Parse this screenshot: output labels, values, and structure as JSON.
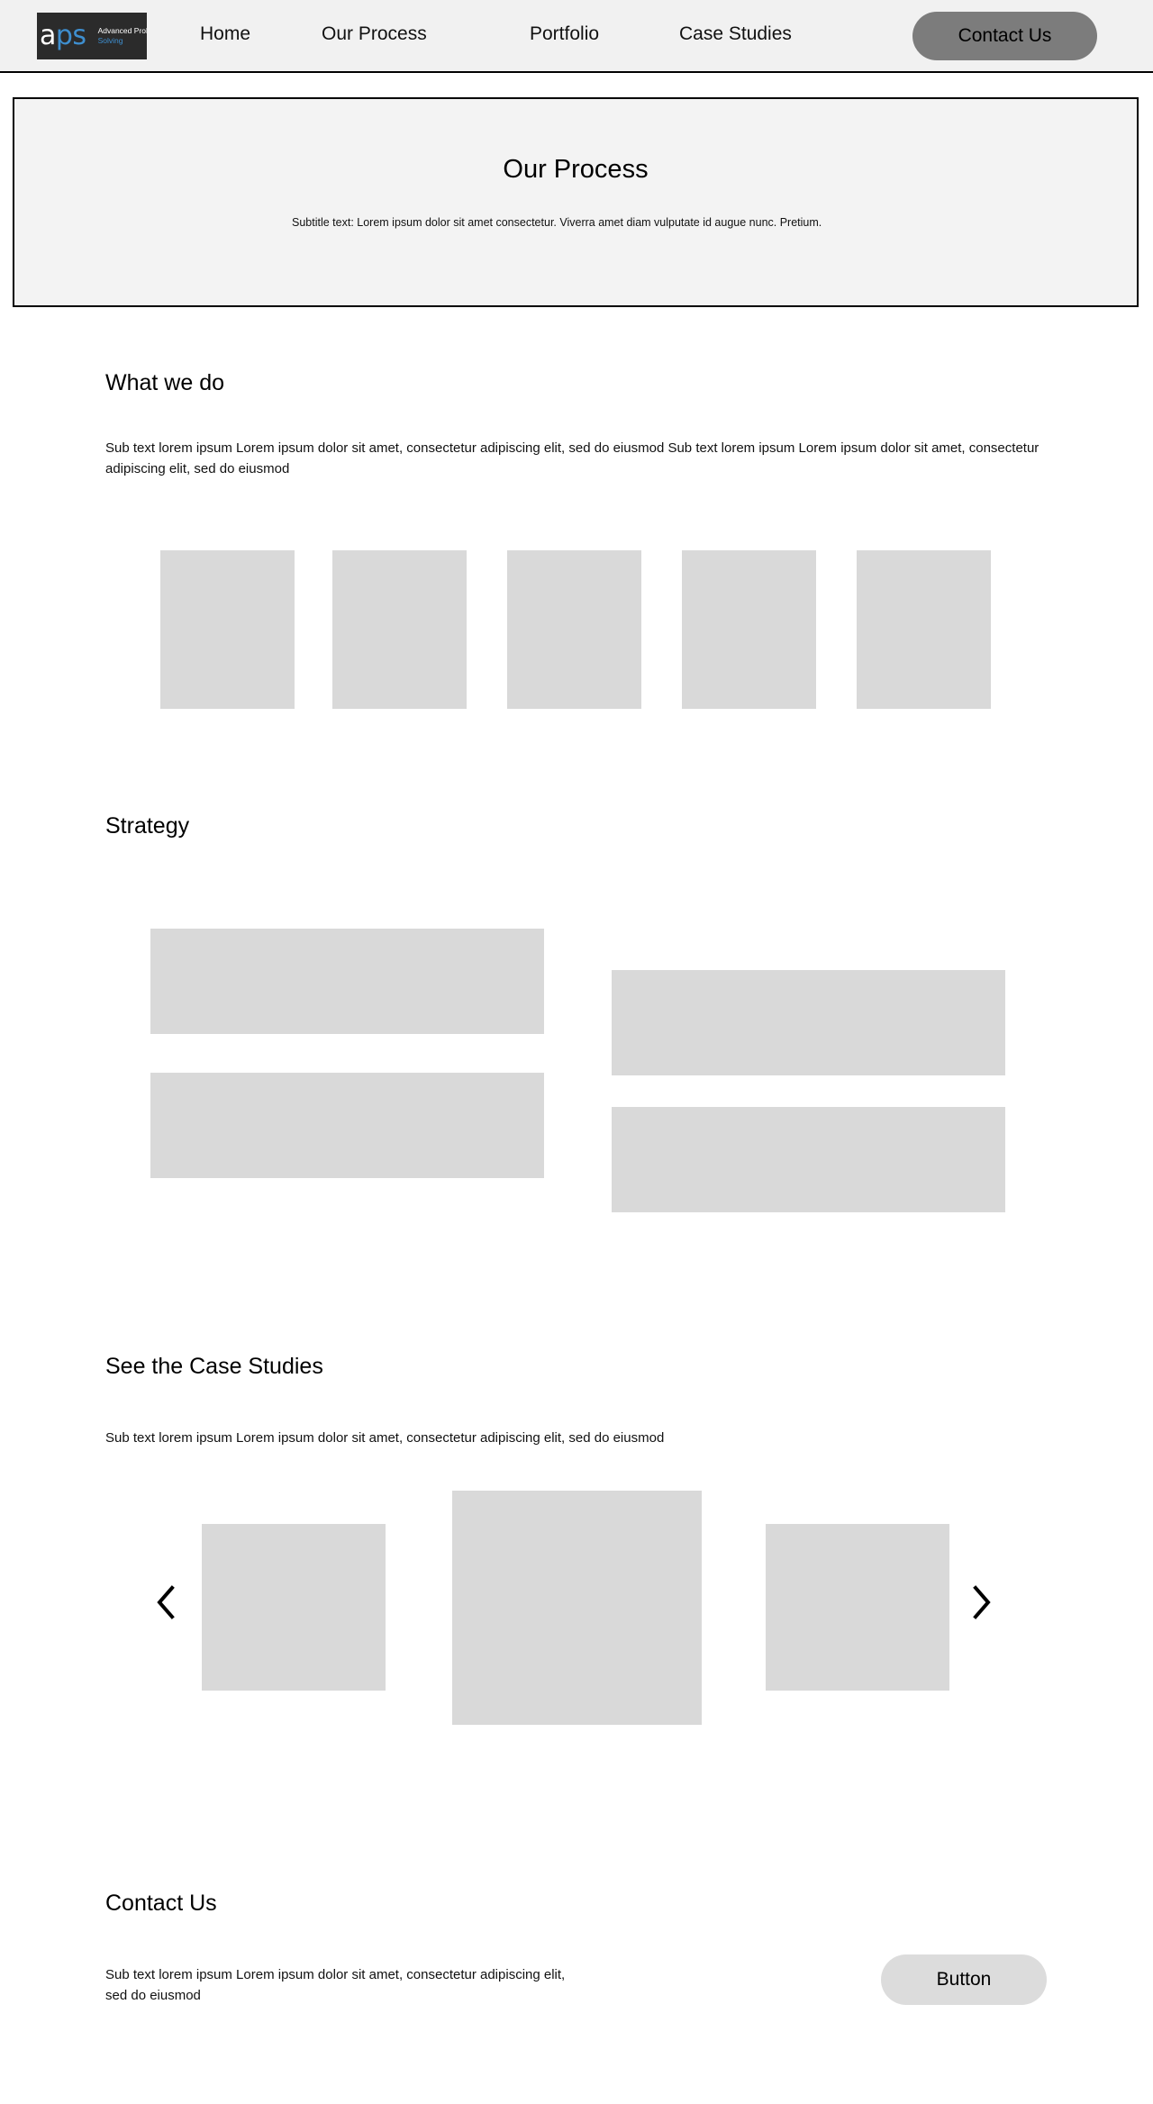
{
  "header": {
    "logo": {
      "mark_a": "a",
      "mark_ps": "ps",
      "tagline_line1": "Advanced Problem",
      "tagline_line2": "Solving"
    },
    "nav_items": [
      {
        "label": "Home"
      },
      {
        "label": "Our Process"
      },
      {
        "label": "Portfolio"
      },
      {
        "label": "Case Studies"
      }
    ],
    "contact_button_label": "Contact Us"
  },
  "hero": {
    "title": "Our Process",
    "subtitle": "Subtitle text: Lorem ipsum dolor sit amet consectetur. Viverra amet diam vulputate id augue nunc. Pretium."
  },
  "what_we_do": {
    "title": "What we do",
    "subtitle": "Sub text lorem ipsum Lorem ipsum dolor sit amet, consectetur adipiscing elit, sed do eiusmod Sub text lorem ipsum Lorem ipsum dolor sit amet, consectetur adipiscing elit, sed do eiusmod",
    "cards": [
      {
        "label": ""
      },
      {
        "label": ""
      },
      {
        "label": ""
      },
      {
        "label": ""
      },
      {
        "label": ""
      }
    ]
  },
  "strategy": {
    "title": "Strategy",
    "cards": [
      {
        "label": ""
      },
      {
        "label": ""
      },
      {
        "label": ""
      },
      {
        "label": ""
      }
    ]
  },
  "case_studies": {
    "title": "See the Case Studies",
    "subtitle": "Sub text lorem ipsum Lorem ipsum dolor sit amet, consectetur adipiscing elit, sed do eiusmod",
    "prev_icon": "chevron-left-icon",
    "next_icon": "chevron-right-icon",
    "slides": [
      {
        "label": ""
      },
      {
        "label": ""
      },
      {
        "label": ""
      }
    ]
  },
  "contact": {
    "title": "Contact Us",
    "subtitle": "Sub text lorem ipsum Lorem ipsum dolor sit amet, consectetur adipiscing elit, sed do eiusmod",
    "button_label": "Button"
  },
  "colors": {
    "page_background": "#ffffff",
    "nav_background": "#f1f1f1",
    "hero_background": "#f3f3f3",
    "placeholder": "#d9d9d9",
    "contact_button": "#7c7c7c",
    "footer_button": "#dcdcdc",
    "logo_background": "#2b2b2b",
    "logo_accent": "#3e8fd0",
    "border": "#000000"
  }
}
